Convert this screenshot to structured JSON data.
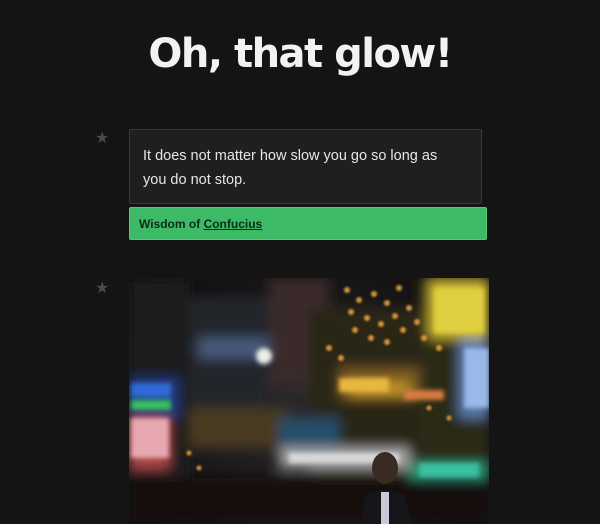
{
  "header": {
    "title": "Oh, that glow!"
  },
  "posts": [
    {
      "type": "quote",
      "icon": "star-icon",
      "text": "It does not matter how slow you go so long as you do not stop.",
      "attribution_prefix": "Wisdom of ",
      "attribution_link": "Confucius"
    },
    {
      "type": "photo",
      "icon": "star-icon"
    }
  ],
  "colors": {
    "background": "#141414",
    "attribution_bg": "#3dba66",
    "quote_bg": "#1f1f1f"
  }
}
